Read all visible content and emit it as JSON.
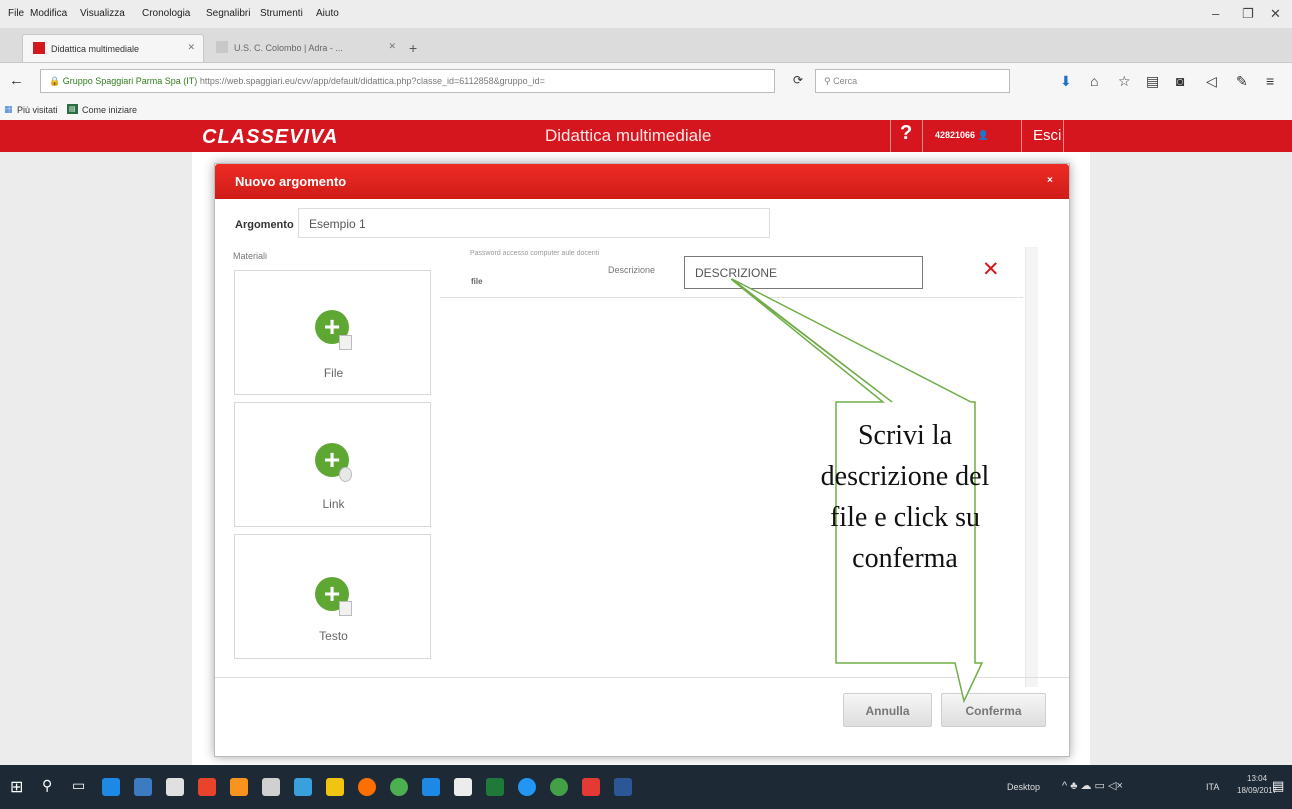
{
  "menubar": {
    "items": [
      "File",
      "Modifica",
      "Visualizza",
      "Cronologia",
      "Segnalibri",
      "Strumenti",
      "Aiuto"
    ]
  },
  "tabs": [
    {
      "label": "Didattica multimediale",
      "active": true
    },
    {
      "label": "U.S. C. Colombo | Adra - ...",
      "active": false
    }
  ],
  "navbar": {
    "site_identity": "Gruppo Spaggiari Parma Spa (IT)",
    "url": "https://web.spaggiari.eu/cvv/app/default/didattica.php?classe_id=6112858&gruppo_id=",
    "search_placeholder": "Cerca"
  },
  "bookmarks": [
    "Più visitati",
    "Come iniziare"
  ],
  "app": {
    "logo": "CLASSEVIVA",
    "title": "Didattica multimediale",
    "help": "?",
    "user_code": "42821066",
    "exit": "Esci"
  },
  "modal": {
    "title": "Nuovo argomento",
    "close": "×",
    "argomento_label": "Argomento",
    "argomento_value": "Esempio 1",
    "materiali_label": "Materiali",
    "cards": [
      {
        "label": "File"
      },
      {
        "label": "Link"
      },
      {
        "label": "Testo"
      }
    ],
    "file_item": {
      "name": "Password accesso computer aule docenti",
      "type": "file",
      "description_label": "Descrizione",
      "description_value": "DESCRIZIONE",
      "remove": "✕"
    },
    "cancel_label": "Annulla",
    "confirm_label": "Conferma"
  },
  "callout": {
    "text_lines": [
      "Scrivi la",
      "descrizione del",
      "file e click su",
      "conferma"
    ],
    "border_color": "#70ad47"
  },
  "taskbar": {
    "desktop_label": "Desktop",
    "language": "ITA",
    "time": "13:04",
    "date": "18/09/2017"
  },
  "colors": {
    "brand_red": "#d6161f",
    "add_green": "#5fa733"
  }
}
